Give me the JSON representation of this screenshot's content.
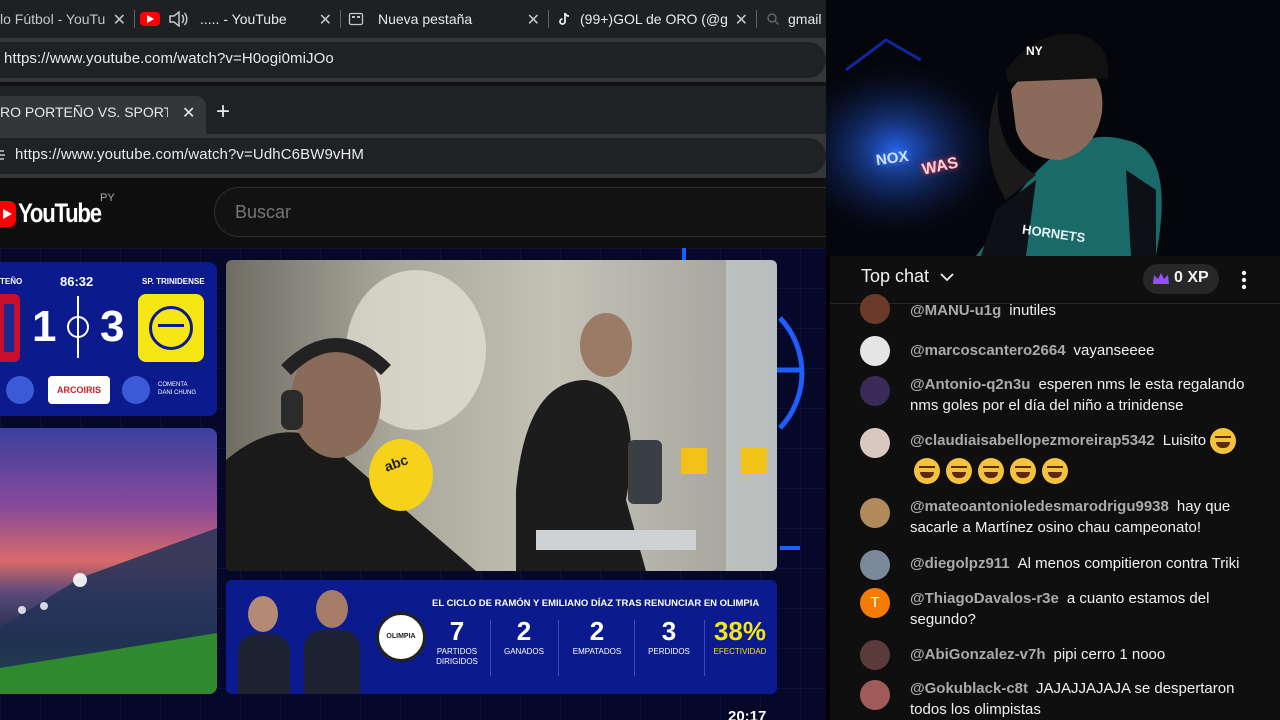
{
  "browser1": {
    "tabs": [
      {
        "label": "lo Fútbol - YouTu",
        "favicon": "youtube-icon"
      },
      {
        "label": "..... - YouTube",
        "favicon": "youtube-icon",
        "audio": "speaker-icon"
      },
      {
        "label": "Nueva pestaña",
        "favicon": "new-tab-icon"
      },
      {
        "label": "(99+)GOL de ORO (@g",
        "favicon": "tiktok-icon"
      },
      {
        "label": "gmail",
        "favicon": "search-icon"
      }
    ],
    "url": "https://www.youtube.com/watch?v=H0ogi0miJOo"
  },
  "browser2": {
    "tab_label": "RO PORTEÑO VS. SPORTIVO T",
    "new_tab_symbol": "+",
    "url": "https://www.youtube.com/watch?v=UdhC6BW9vHM"
  },
  "youtube": {
    "logo_text": "YouTube",
    "country": "PY",
    "search_placeholder": "Buscar"
  },
  "scoreboard": {
    "home_team": "TEÑO",
    "away_team": "SP. TRINIDENSE",
    "clock": "86:32",
    "home_score": "1",
    "away_score": "3",
    "sponsor": "ARCOIRIS",
    "commentator_role": "COMENTA",
    "commentator_name": "DANI CHUNG"
  },
  "mic_brand": "abc",
  "stats_panel": {
    "title": "EL CICLO DE RAMÓN Y EMILIANO DÍAZ TRAS RENUNCIAR EN OLIMPIA",
    "badge": "OLIMPIA",
    "stats": [
      {
        "value": "7",
        "label": "PARTIDOS DIRIGIDOS"
      },
      {
        "value": "2",
        "label": "GANADOS"
      },
      {
        "value": "2",
        "label": "EMPATADOS"
      },
      {
        "value": "3",
        "label": "PERDIDOS"
      },
      {
        "value": "38%",
        "label": "EFECTIVIDAD"
      }
    ]
  },
  "video_time": "20:17",
  "webcam": {
    "sign_left": "NOX",
    "sign_right": "WAS",
    "jersey_text": "HORNETS",
    "cap_logo": "NY"
  },
  "chat": {
    "mode": "Top chat",
    "xp": "0 XP",
    "messages": [
      {
        "author": "@MANU-u1g",
        "text": "inutiles"
      },
      {
        "author": "@marcoscantero2664",
        "text": "vayanseeee"
      },
      {
        "author": "@Antonio-q2n3u",
        "text": "esperen nms le esta regalando nms goles por el día del niño a trinidense"
      },
      {
        "author": "@claudiaisabellopezmoreirap5342",
        "text": "Luisito"
      },
      {
        "author": "@mateoantonioledesmarodrigu9938",
        "text": "hay que sacarle a Martínez osino chau campeonato!"
      },
      {
        "author": "@diegolpz911",
        "text": "Al menos compitieron contra Triki"
      },
      {
        "author": "@ThiagoDavalos-r3e",
        "text": "a cuanto estamos del segundo?",
        "initial": "T"
      },
      {
        "author": "@AbiGonzalez-v7h",
        "text": "pipi cerro 1 nooo"
      },
      {
        "author": "@Gokublack-c8t",
        "text": "JAJAJJAJAJA se despertaron todos los olimpistas"
      }
    ]
  },
  "colors": {
    "accent_red": "#ff0000",
    "scoreboard_blue": "#0b1a8c",
    "trinidense_yellow": "#f5e614",
    "chat_author": "#aaaaaa",
    "thiago_avatar": "#f57c00"
  }
}
